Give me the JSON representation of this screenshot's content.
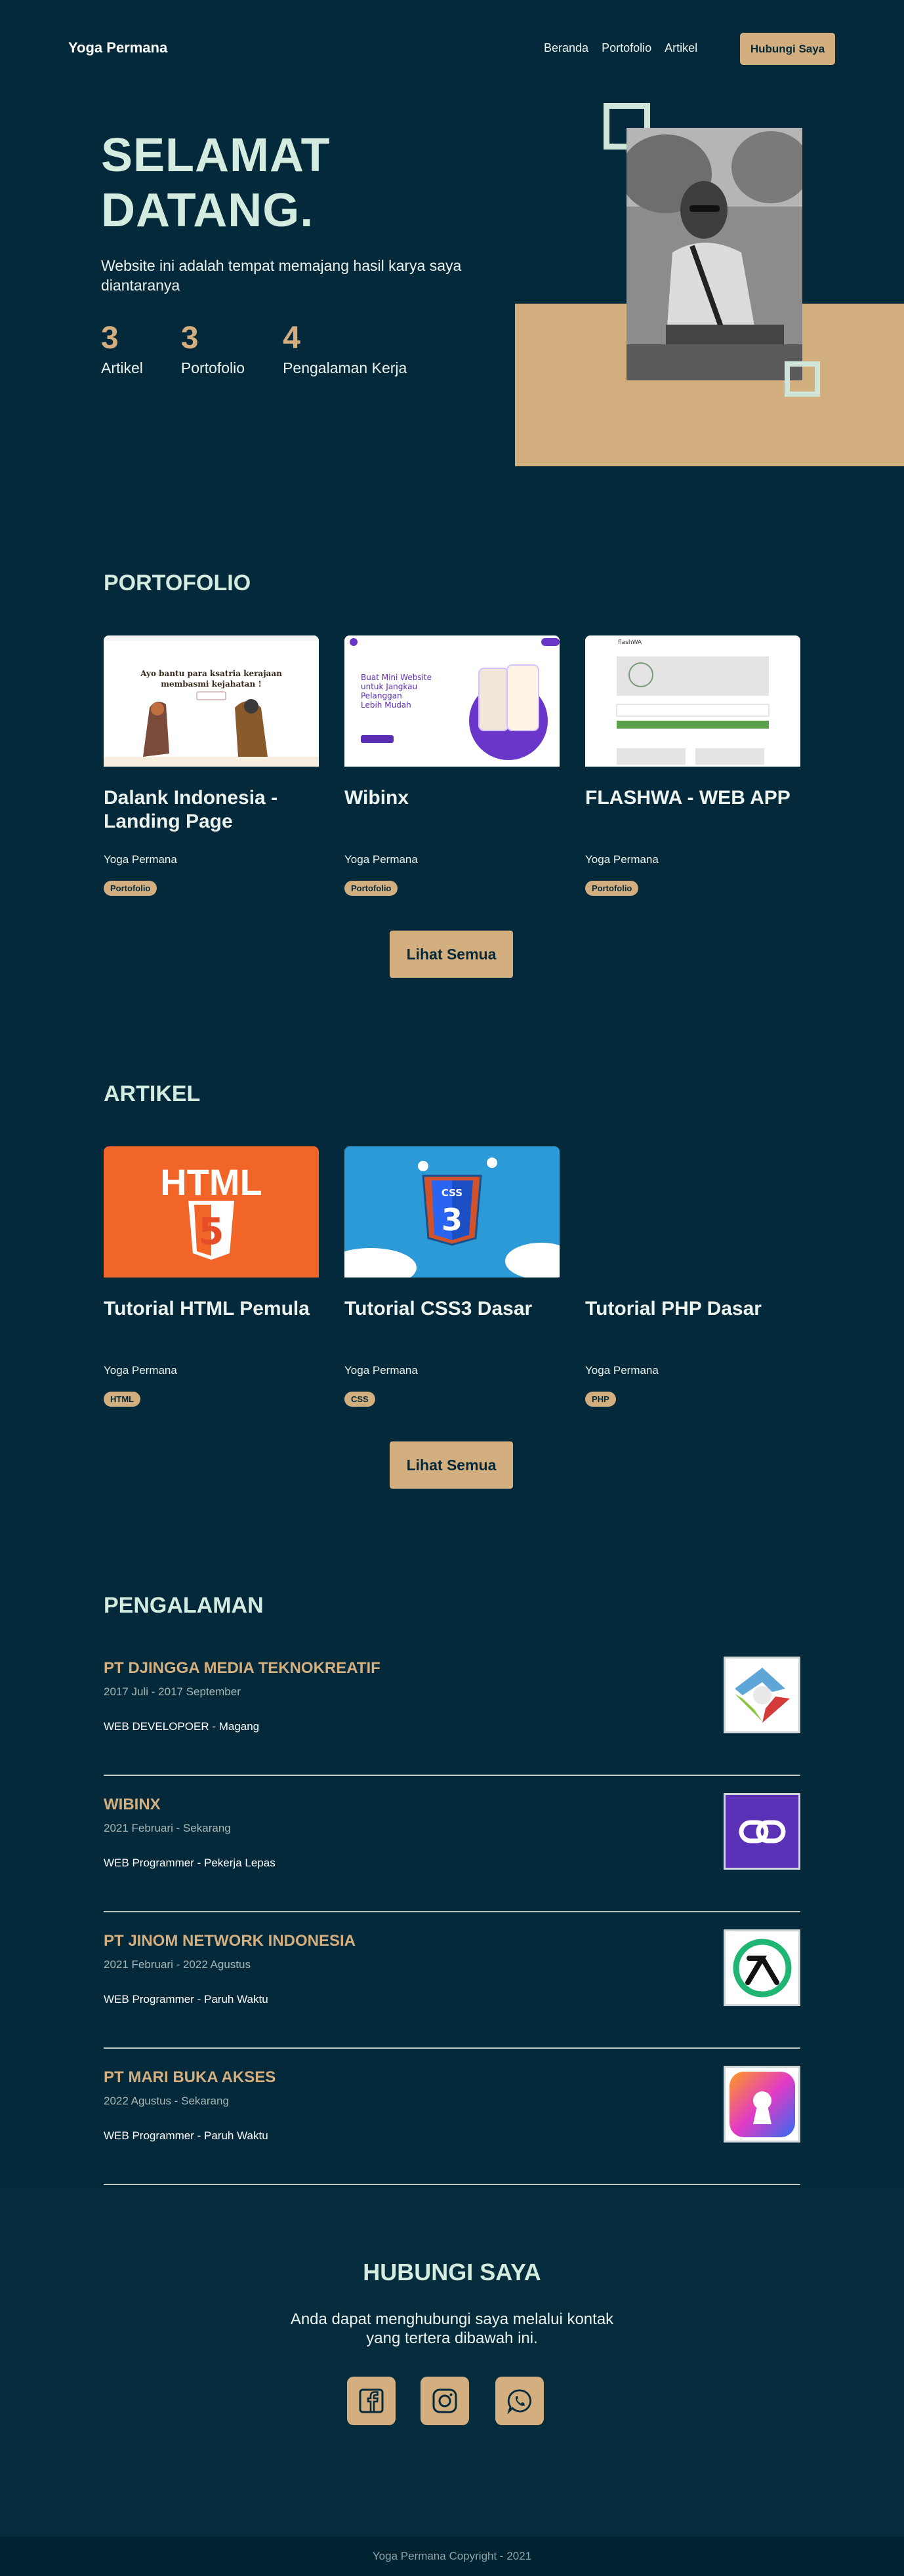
{
  "nav": {
    "brand": "Yoga Permana",
    "links": [
      "Beranda",
      "Portofolio",
      "Artikel"
    ],
    "cta": "Hubungi Saya"
  },
  "hero": {
    "title_line1": "SELAMAT",
    "title_line2": "DATANG.",
    "description": "Website ini adalah tempat memajang hasil karya saya diantaranya",
    "stats": [
      {
        "num": "3",
        "label": "Artikel"
      },
      {
        "num": "3",
        "label": "Portofolio"
      },
      {
        "num": "4",
        "label": "Pengalaman Kerja"
      }
    ]
  },
  "portfolio": {
    "title": "PORTOFOLIO",
    "items": [
      {
        "title": "Dalank Indonesia - Landing Page",
        "author": "Yoga Permana",
        "tag": "Portofolio",
        "preview_text": "Ayo bantu para ksatria kerajaan membasmi kejahatan !"
      },
      {
        "title": "Wibinx",
        "author": "Yoga Permana",
        "tag": "Portofolio",
        "preview_text": "Buat Mini Website untuk Jangkau Pelanggan Lebih Mudah"
      },
      {
        "title": "FLASHWA - WEB APP",
        "author": "Yoga Permana",
        "tag": "Portofolio",
        "preview_text": "flashWA"
      }
    ],
    "button": "Lihat Semua"
  },
  "articles": {
    "title": "ARTIKEL",
    "items": [
      {
        "title": "Tutorial HTML Pemula",
        "author": "Yoga Permana",
        "tag": "HTML",
        "image_text": "HTML",
        "image_num": "5"
      },
      {
        "title": "Tutorial CSS3 Dasar",
        "author": "Yoga Permana",
        "tag": "CSS",
        "image_text": "CSS",
        "image_num": "3"
      },
      {
        "title": "Tutorial PHP Dasar",
        "author": "Yoga Permana",
        "tag": "PHP"
      }
    ],
    "button": "Lihat Semua"
  },
  "experience": {
    "title": "PENGALAMAN",
    "items": [
      {
        "company": "PT DJINGGA MEDIA TEKNOKREATIF",
        "date": "2017 Juli - 2017 September",
        "role": "WEB DEVELOPOER - Magang",
        "logo": "djingga-logo"
      },
      {
        "company": "WIBINX",
        "date": "2021 Februari - Sekarang",
        "role": "WEB Programmer - Pekerja Lepas",
        "logo": "wibinx-logo"
      },
      {
        "company": "PT JINOM NETWORK INDONESIA",
        "date": "2021 Februari - 2022 Agustus",
        "role": "WEB Programmer - Paruh Waktu",
        "logo": "jinom-logo"
      },
      {
        "company": "PT MARI BUKA AKSES",
        "date": "2022 Agustus - Sekarang",
        "role": "WEB Programmer - Paruh Waktu",
        "logo": "maribuka-logo"
      }
    ]
  },
  "contact": {
    "title": "HUBUNGI SAYA",
    "description": "Anda dapat menghubungi saya melalui kontak yang tertera dibawah ini.",
    "socials": [
      "facebook-icon",
      "instagram-icon",
      "whatsapp-icon"
    ]
  },
  "footer": {
    "text": "Yoga Permana Copyright - 2021"
  },
  "colors": {
    "background": "#04293a",
    "accent": "#d3ae7f",
    "heading": "#d4ebdf"
  }
}
